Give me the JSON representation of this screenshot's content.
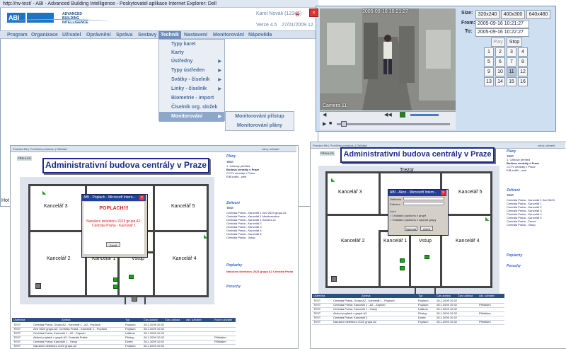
{
  "main_window": {
    "title": "http://rw-test/ - ABI - Advanced Building Intelligence - Poskytovatel aplikace Internet Explorer: Dell",
    "logo_text": "ABI",
    "brand_line1": "ADVANCED",
    "brand_line2": "BUILDING INTELLIGENCE",
    "user": "Karel Novák (12345)",
    "version": "Verze 4.5",
    "date": "27/01/2009 12",
    "menu": [
      "Program",
      "Organizace",
      "Uživatel",
      "Oprávnění",
      "Správa",
      "Sestavy",
      "Technik",
      "Nastavení",
      "Monitorování",
      "Nápověda"
    ],
    "active_menu": "Technik",
    "dropdown": [
      {
        "label": "Typy karet",
        "has_sub": false
      },
      {
        "label": "Karty",
        "has_sub": false
      },
      {
        "label": "Ústředny",
        "has_sub": true
      },
      {
        "label": "Typy ústředen",
        "has_sub": true
      },
      {
        "label": "Svátky - číselník",
        "has_sub": true
      },
      {
        "label": "Linky - číselník",
        "has_sub": true
      },
      {
        "label": "Biometrie - import",
        "has_sub": false
      },
      {
        "label": "Číselník org. složek",
        "has_sub": false
      },
      {
        "label": "Monitorování",
        "has_sub": true
      }
    ],
    "submenu": [
      "Monitorování přístup",
      "Monitorování plány"
    ],
    "taskbar_fragment": "Hot"
  },
  "camera": {
    "timestamp": "2005-09-16 10:21:27",
    "camera_label": "Camera 11",
    "size_label": "Size:",
    "sizes": [
      "320x240",
      "400x300",
      "640x480"
    ],
    "from_label": "From:",
    "from_value": "2005-09-16 10:21:27",
    "to_label": "To:",
    "to_value": "2005-09-16 10:22:27",
    "play_label": "Play",
    "stop_label": "Stop",
    "camera_numbers": [
      "1",
      "2",
      "3",
      "4",
      "5",
      "6",
      "7",
      "8",
      "9",
      "10",
      "11",
      "12",
      "13",
      "14",
      "15",
      "16"
    ],
    "selected_camera": "11",
    "close_symbol": "×"
  },
  "plan_left": {
    "toolbar": "Protokol filtr | Prohlížeč protokolu | Odhlásit",
    "user_label": "zdroj: uživatel",
    "back_label": "PŘEHLED",
    "title": "Administrativní budova centrály v Praze",
    "rooms": [
      "Kancelář 3",
      "Kancelář 5",
      "Kancelář 2",
      "Kancelář 1",
      "Vstup",
      "Kancelář 4"
    ],
    "plans_header": "Plány",
    "plans_sub": "TEST",
    "plans_items": [
      "1. Celkový přehled",
      "Budova centrály v Praze",
      "CCTV centrály v Praze",
      "EIB kufřík - web"
    ],
    "devices_header": "Zařízení",
    "devices_sub": "TEST",
    "device_rows": [
      "Centrála Praha - Kancelář 1 Zeď 2623 grupa A1",
      "Centrála Praha - Kancelář 1 Monitorováno",
      "Centrála Praha - Kancelář 1 Kamera 11",
      "Centrála Praha - Kancelář 2",
      "Centrála Praha - Kancelář 3",
      "Centrála Praha - Kancelář 4",
      "Centrála Praha - Kancelář 5",
      "Centrála Praha - Vstup"
    ],
    "alarms_header": "Poplachy",
    "alarm_text": "Narušení detektoru 2023 grupa A2 Centrála Praha",
    "faults_header": "Poruchy",
    "dialog_title": "ABI - Poplach - Microsoft Intern...",
    "dialog_alarm": "POPLACH!!!",
    "dialog_message": "Narušení detektoru 2023 grupa A2: Centrála Praha - Kancelář 1",
    "dialog_button": "Zavřít",
    "grid_headers": [
      "Ústředna",
      "Zpráva",
      "Typ",
      "Čas zprávy",
      "Čas událost.",
      "Akt. uživatel",
      "Ruční uživatel"
    ],
    "grid_rows": [
      [
        "TEST",
        "Centrála Praha, Grupa A2 - Kancelář 1 - A2 - Poplach",
        "Poplach",
        "28.1.2009 10:32",
        "",
        ""
      ],
      [
        "TEST",
        "Zeď 3623 grupa A2: Centrála Praha - Kancelář 1 - Poplach",
        "Poplach",
        "28.1.2009 10:32",
        "",
        ""
      ],
      [
        "TEST",
        "Centrála Praha, Kancelář 1 - A2 - Zapnutí",
        "Událost",
        "28.1.2009 10:32",
        "",
        ""
      ],
      [
        "TEST",
        "Aktivní poplach v grupě A2: Centrála Praha",
        "Přístup",
        "28.1.2009 10:32",
        "",
        "Přihlášen"
      ],
      [
        "TEST",
        "Centrála Praha: Kancelář 1 - Vstup",
        "Dveře",
        "28.1.2009 10:32",
        "",
        "Přihlášen"
      ],
      [
        "TEST",
        "Narušení detektoru 2023 grupa A2",
        "Poplach",
        "28.1.2009 10:32",
        "",
        "Přihlášen"
      ]
    ]
  },
  "plan_right": {
    "toolbar": "Protokol filtr | Prohlížeč protokolu | Odhlásit",
    "user_label": "zdroj: uživatel",
    "back_label": "PŘEHLED",
    "title": "Administrativní budova centrály v Praze",
    "rooms": [
      "Trezor",
      "Kancelář 3",
      "Kancelář 5",
      "Kancelář 2",
      "Kancelář 1",
      "Vstup",
      "Kancelář 4"
    ],
    "plans_header": "Plány",
    "plans_sub": "TEST",
    "plans_items": [
      "1. Celkový přehled",
      "Budova centrály v Praze",
      "CCTV centrály v Praze",
      "EIB kufřík - web"
    ],
    "devices_header": "Zařízení",
    "devices_sub": "TEST",
    "device_rows": [
      "Centrála Praha - Kancelář 1 Zeď 3623",
      "Centrála Praha - Kancelář 1",
      "Centrála Praha - Kancelář 2",
      "Centrála Praha - Kancelář 3",
      "Centrála Praha - Kancelář 4",
      "Centrála Praha - Kancelář 5",
      "Centrála Praha - Trezor",
      "Centrála Praha - Vstup"
    ],
    "alarms_header": "Poplachy",
    "faults_header": "Poruchy",
    "dialog_title": "ABI - Akce - Microsoft Intern...",
    "dialog_fields": [
      "Ústředna",
      "Zařízení"
    ],
    "dialog_section": "Akce",
    "dialog_options": [
      "Ovládání poplachu v grupě",
      "Ovládání poplachu v zapnutí grupy"
    ],
    "dialog_button1": "Vykonat",
    "dialog_button2": "Zavřít",
    "grid_headers": [
      "Ústředna",
      "Zpráva",
      "Typ",
      "Čas zprávy",
      "Čas událost.",
      "Akt. uživatel"
    ],
    "grid_rows": [
      [
        "TEST",
        "Centrála Praha, Grupa A2 - Kancelář 1 - Poplach",
        "Poplach",
        "28.1.2009 10:32",
        "",
        ""
      ],
      [
        "TEST",
        "Centrála Praha: Kancelář 1 - A2 - Zapnutí",
        "Poplach",
        "28.1.2009 10:32",
        "",
        "Přihlášen"
      ],
      [
        "TEST",
        "Centrála Praha: Kancelář 1 - Vstup",
        "Událost",
        "28.1.2009 10:32",
        "",
        ""
      ],
      [
        "TEST",
        "Aktivní poplach v grupě A2",
        "Přístup",
        "28.1.2009 10:32",
        "",
        "Přihlášen"
      ],
      [
        "TEST",
        "Centrála Praha: Kancelář 3",
        "Dveře",
        "28.1.2009 10:32",
        "",
        ""
      ],
      [
        "TEST",
        "Narušení detektoru 2023 grupa A2",
        "Poplach",
        "28.1.2009 10:32",
        "",
        "Přihlášen"
      ]
    ]
  },
  "colors": {
    "menu_active": "#6f8fbf",
    "title_blue": "#1a2a8a",
    "alarm_red": "#d22",
    "sensor_green": "#2a9a2a"
  }
}
